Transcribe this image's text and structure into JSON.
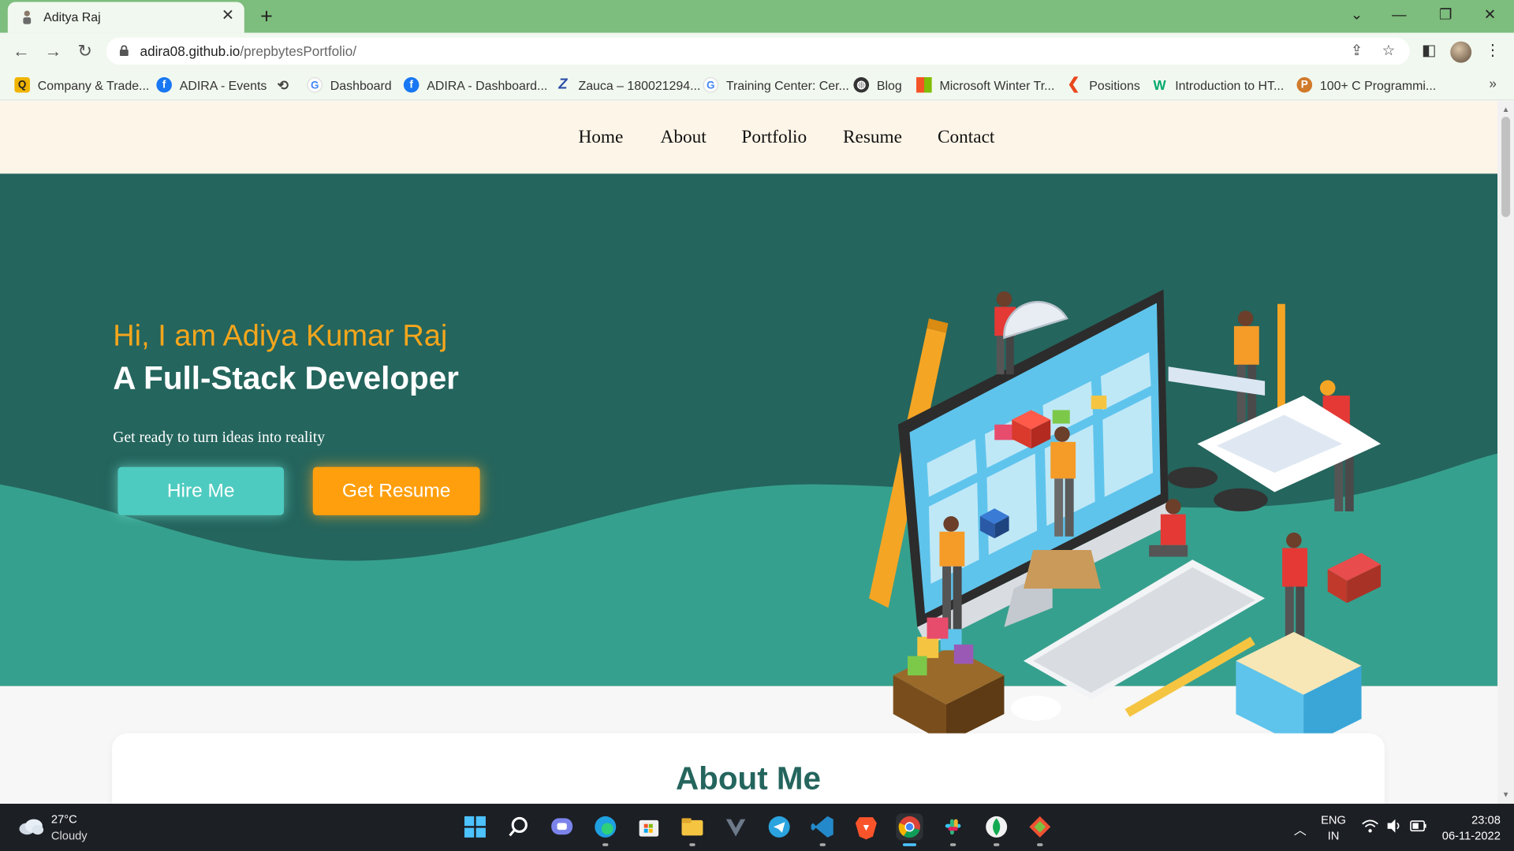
{
  "browser": {
    "tab_title": "Aditya Raj",
    "url_host": "adira08.github.io",
    "url_path": "/prepbytesPortfolio/",
    "bookmarks": [
      {
        "label": "Company & Trade...",
        "icon": "quora-icon",
        "color": "#f0b400"
      },
      {
        "label": "ADIRA - Events",
        "icon": "facebook-icon",
        "color": "#1877f2"
      },
      {
        "label": "",
        "icon": "history-icon",
        "color": "#444444"
      },
      {
        "label": "Dashboard",
        "icon": "google-icon",
        "color": "#4285f4"
      },
      {
        "label": "ADIRA - Dashboard...",
        "icon": "facebook-icon",
        "color": "#1877f2"
      },
      {
        "label": "Zauca – 180021294...",
        "icon": "zauca-icon",
        "color": "#2b4ea8"
      },
      {
        "label": "Training Center: Cer...",
        "icon": "google-icon",
        "color": "#4285f4"
      },
      {
        "label": "Blog",
        "icon": "globe-icon",
        "color": "#333333"
      },
      {
        "label": "Microsoft Winter Tr...",
        "icon": "microsoft-icon",
        "color": "#f35325"
      },
      {
        "label": "Positions",
        "icon": "positions-icon",
        "color": "#e8471c"
      },
      {
        "label": "Introduction to HT...",
        "icon": "w3schools-icon",
        "color": "#04aa6d"
      },
      {
        "label": "100+ C Programmi...",
        "icon": "programiz-icon",
        "color": "#d07a2b"
      }
    ]
  },
  "site": {
    "nav": [
      "Home",
      "About",
      "Portfolio",
      "Resume",
      "Contact"
    ],
    "hero": {
      "greeting": "Hi, I am Adiya Kumar Raj",
      "headline": "A Full-Stack Developer",
      "tagline": "Get ready to turn ideas into reality",
      "hire_label": "Hire Me",
      "resume_label": "Get Resume"
    },
    "about_title": "About Me",
    "colors": {
      "hero_bg": "#24655d",
      "wave": "#36a08e",
      "accent_orange": "#ff9f0d",
      "accent_teal": "#4ecbc0",
      "nav_bg": "#fdf5e8"
    }
  },
  "taskbar": {
    "temperature": "27°C",
    "weather": "Cloudy",
    "lang_1": "ENG",
    "lang_2": "IN",
    "time": "23:08",
    "date": "06-11-2022"
  }
}
